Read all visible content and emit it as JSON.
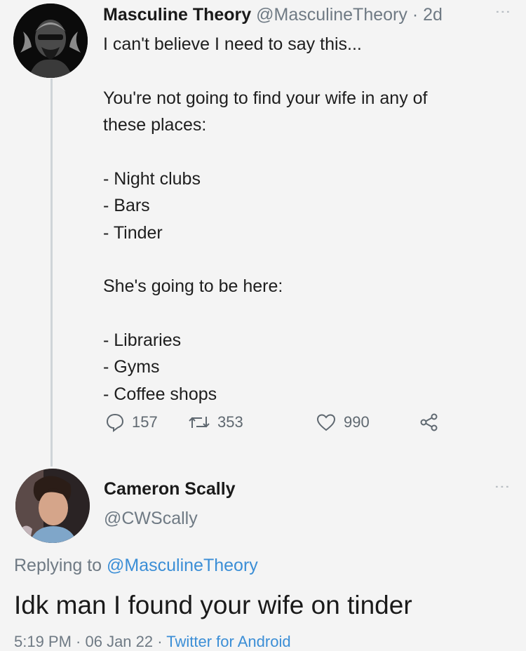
{
  "tweet": {
    "author_name": "Masculine Theory",
    "author_handle": "@MasculineTheory",
    "separator": "·",
    "age": "2d",
    "lines": [
      "I can't believe I need to say this...",
      "",
      "You're not going to find your wife in any of",
      "these places:",
      "",
      "- Night clubs",
      "- Bars",
      "- Tinder",
      "",
      "She's going to be here:",
      "",
      "- Libraries",
      "- Gyms",
      "- Coffee shops"
    ],
    "stats": {
      "replies": "157",
      "retweets": "353",
      "likes": "990"
    }
  },
  "reply": {
    "author_name": "Cameron Scally",
    "author_handle": "@CWScally",
    "replying_prefix": "Replying to",
    "replying_to": "@MasculineTheory",
    "text": "Idk man I found your wife on tinder",
    "timestamp": "5:19 PM · 06 Jan 22 ·",
    "source": "Twitter for Android"
  },
  "icons": {
    "reply": "comment-icon",
    "retweet": "retweet-icon",
    "like": "heart-icon",
    "share": "share-icon",
    "more": "more-vertical-icon"
  },
  "colors": {
    "background": "#f4f4f4",
    "link": "#3b8ed6",
    "muted": "#6f7a84"
  }
}
